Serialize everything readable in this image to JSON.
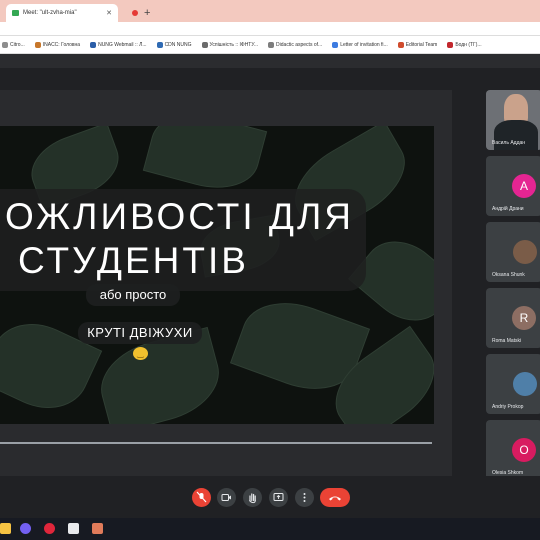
{
  "browser": {
    "tabs": [
      {
        "label": "Meet: \"ult-zvha-mia\"",
        "icon": "meet-icon"
      }
    ],
    "new_tab_glyph": "+",
    "close_glyph": "✕",
    "bookmarks": [
      {
        "label": "Citro...",
        "color": "#8d8d8d"
      },
      {
        "label": "INACC: Головна",
        "color": "#c7772a"
      },
      {
        "label": "NUNG Webmail :: Л...",
        "color": "#2b5ea8"
      },
      {
        "label": "CDN NUNG",
        "color": "#2f6ab3"
      },
      {
        "label": "Успішність :: ІФНТУ...",
        "color": "#6b6b6b"
      },
      {
        "label": "Didactic aspects of...",
        "color": "#7d7d7d"
      },
      {
        "label": "Letter of invitation fi...",
        "color": "#3d7be0"
      },
      {
        "label": "Editorial Team",
        "color": "#d04c2d"
      },
      {
        "label": "Бодн (ТГ)...",
        "color": "#c2272d"
      }
    ]
  },
  "slide": {
    "title_line1": "ОЖЛИВОСТІ ДЛЯ",
    "title_line2": "СТУДЕНТІВ",
    "subtitle1": "або просто",
    "subtitle2": "КРУТІ ДВІЖУХИ",
    "emoji": "😊"
  },
  "participants": [
    {
      "name": "Василь Аддан",
      "type": "video"
    },
    {
      "name": "Андрій Драни",
      "initial": "A",
      "color": "#e52592"
    },
    {
      "name": "Oksana Shunk",
      "type": "photo",
      "color": "#7a5c48"
    },
    {
      "name": "Roma Matski",
      "initial": "R",
      "color": "#8d6e63"
    },
    {
      "name": "Andriy Prokop",
      "type": "photo",
      "color": "#4f7fa8"
    },
    {
      "name": "Olesia Shkom",
      "initial": "O",
      "color": "#d81b60"
    }
  ],
  "controls": {
    "mic_icon": "mic-off-icon",
    "camera_icon": "camera-icon",
    "hand_icon": "raise-hand-icon",
    "present_icon": "present-icon",
    "more_icon": "more-options-icon",
    "end_icon": "end-call-icon"
  }
}
